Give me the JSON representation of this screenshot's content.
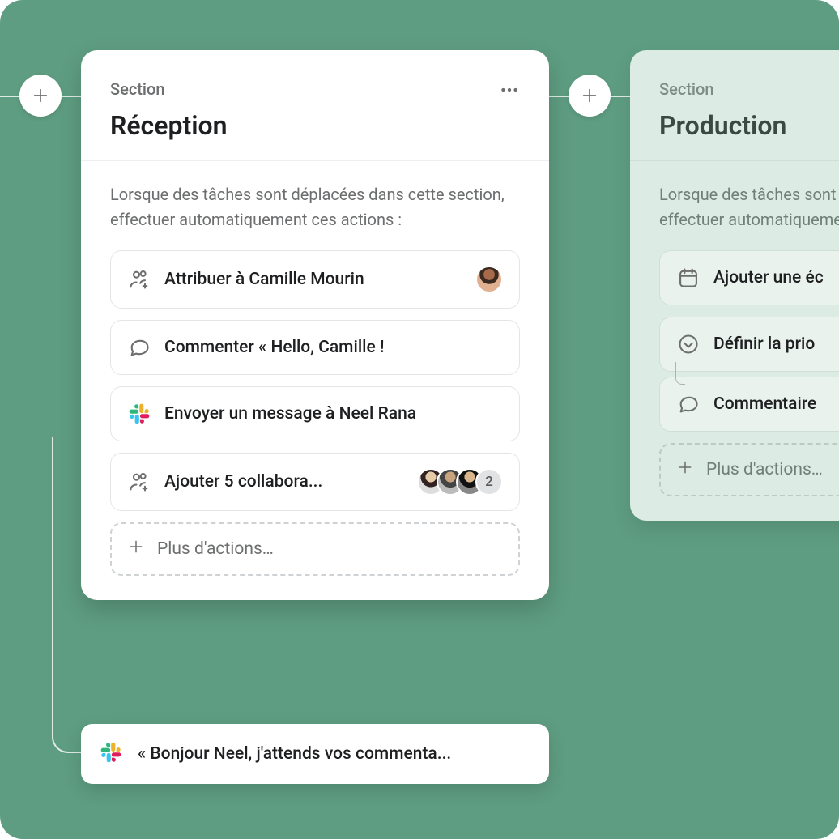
{
  "sections": {
    "reception": {
      "label": "Section",
      "title": "Réception",
      "description": "Lorsque des tâches sont déplacées dans cette section, effectuer automatiquement ces actions :",
      "actions": {
        "assign": "Attribuer à Camille Mourin",
        "comment": "Commenter « Hello, Camille !",
        "slack": "Envoyer un message à Neel Rana",
        "collab": "Ajouter 5 collabora...",
        "collab_extra_count": "2"
      },
      "more": "Plus d'actions…"
    },
    "production": {
      "label": "Section",
      "title": "Production",
      "description": "Lorsque des tâches sont déplacées dans cette section, effectuer automatiquement ces actions :",
      "actions": {
        "date": "Ajouter une éc",
        "priority": "Définir la prio",
        "comment": "Commentaire"
      },
      "more": "Plus d'actions…"
    }
  },
  "bubble": {
    "text": "« Bonjour Neel, j'attends vos commenta..."
  }
}
